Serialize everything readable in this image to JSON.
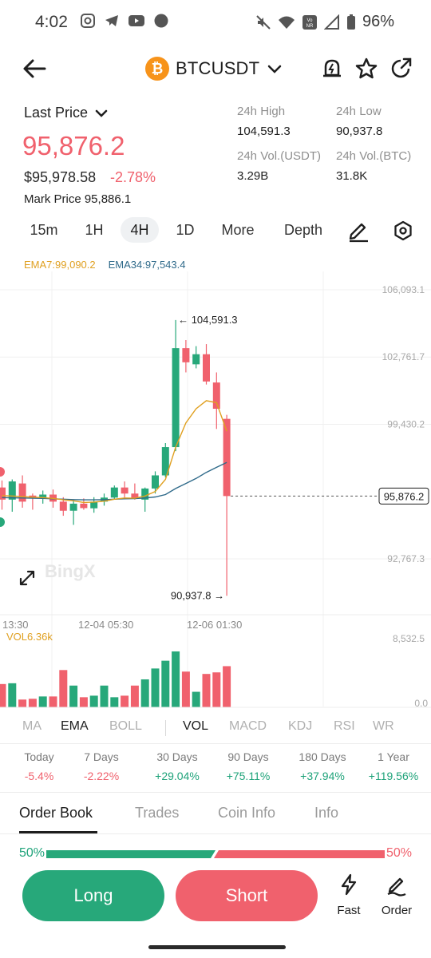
{
  "status_bar": {
    "time": "4:02",
    "battery": "96%",
    "network_badge": "Vo NR"
  },
  "header": {
    "coin_symbol": "₿",
    "pair": "BTCUSDT"
  },
  "price": {
    "label": "Last Price",
    "last": "95,876.2",
    "usd": "$95,978.58",
    "change": "-2.78%",
    "mark": "Mark Price 95,886.1"
  },
  "stats": {
    "high_label": "24h High",
    "high_value": "104,591.3",
    "low_label": "24h Low",
    "low_value": "90,937.8",
    "vol_usdt_label": "24h Vol.(USDT)",
    "vol_usdt_value": "3.29B",
    "vol_btc_label": "24h Vol.(BTC)",
    "vol_btc_value": "31.8K"
  },
  "timeframes": [
    "15m",
    "1H",
    "4H",
    "1D",
    "More",
    "Depth"
  ],
  "ema_legend": {
    "ema7": "EMA7:99,090.2",
    "ema34": "EMA34:97,543.4"
  },
  "chart_data": {
    "type": "candlestick",
    "y_axis_labels": [
      "106,093.1",
      "102,761.7",
      "99,430.2",
      "92,767.3"
    ],
    "ylim": [
      90000,
      107000
    ],
    "current_price_tag": "95,876.2",
    "high_annotation": "104,591.3",
    "low_annotation": "90,937.8",
    "x_labels": [
      "13:30",
      "12-04 05:30",
      "12-06 01:30"
    ],
    "watermark": "BingX",
    "candles": [
      {
        "o": 96300,
        "h": 96650,
        "l": 95200,
        "c": 95700
      },
      {
        "o": 95700,
        "h": 96700,
        "l": 95100,
        "c": 96600
      },
      {
        "o": 96500,
        "h": 96900,
        "l": 95300,
        "c": 95600
      },
      {
        "o": 95900,
        "h": 96000,
        "l": 95200,
        "c": 95780
      },
      {
        "o": 95800,
        "h": 96150,
        "l": 95500,
        "c": 95950
      },
      {
        "o": 95950,
        "h": 96200,
        "l": 95300,
        "c": 95600
      },
      {
        "o": 95600,
        "h": 95820,
        "l": 94900,
        "c": 95150
      },
      {
        "o": 95150,
        "h": 95700,
        "l": 94450,
        "c": 95500
      },
      {
        "o": 95500,
        "h": 95760,
        "l": 95200,
        "c": 95280
      },
      {
        "o": 95270,
        "h": 95820,
        "l": 95050,
        "c": 95600
      },
      {
        "o": 95600,
        "h": 96000,
        "l": 95400,
        "c": 95800
      },
      {
        "o": 95800,
        "h": 96400,
        "l": 95700,
        "c": 96300
      },
      {
        "o": 96300,
        "h": 96600,
        "l": 95800,
        "c": 96000
      },
      {
        "o": 96000,
        "h": 96500,
        "l": 95700,
        "c": 95750
      },
      {
        "o": 95700,
        "h": 96300,
        "l": 95100,
        "c": 96250
      },
      {
        "o": 96250,
        "h": 97100,
        "l": 96000,
        "c": 96900
      },
      {
        "o": 96900,
        "h": 98500,
        "l": 96800,
        "c": 98300
      },
      {
        "o": 98300,
        "h": 104591.3,
        "l": 98100,
        "c": 103200
      },
      {
        "o": 103200,
        "h": 103600,
        "l": 102000,
        "c": 102500
      },
      {
        "o": 102400,
        "h": 103300,
        "l": 102200,
        "c": 102900
      },
      {
        "o": 102900,
        "h": 103400,
        "l": 101400,
        "c": 101550
      },
      {
        "o": 101500,
        "h": 102000,
        "l": 99200,
        "c": 100200
      },
      {
        "o": 99700,
        "h": 99900,
        "l": 90937.8,
        "c": 95876.2
      }
    ],
    "ema7": [
      95900,
      95880,
      95850,
      95820,
      95800,
      95760,
      95690,
      95640,
      95560,
      95580,
      95620,
      95720,
      95780,
      95770,
      95880,
      96100,
      96700,
      98300,
      99500,
      100200,
      100600,
      100500,
      99090.2
    ],
    "ema34": [
      95800,
      95790,
      95780,
      95770,
      95760,
      95740,
      95720,
      95700,
      95690,
      95690,
      95695,
      95720,
      95740,
      95750,
      95780,
      95830,
      95950,
      96250,
      96500,
      96750,
      97050,
      97300,
      97543.4
    ],
    "volume": {
      "label": "VOL6.36k",
      "axis_labels": [
        "8,532.5",
        "0.0"
      ],
      "ylim": [
        0,
        8532.5
      ],
      "values": [
        3000,
        3100,
        1000,
        1100,
        1400,
        1400,
        4800,
        2800,
        1300,
        1500,
        2800,
        1300,
        1500,
        2800,
        3600,
        5000,
        6000,
        7200,
        4600,
        2000,
        4300,
        4500,
        5300
      ]
    }
  },
  "indicators": [
    "MA",
    "EMA",
    "BOLL",
    "VOL",
    "MACD",
    "KDJ",
    "RSI",
    "WR"
  ],
  "performance": [
    {
      "label": "Today",
      "value": "-5.4%"
    },
    {
      "label": "7 Days",
      "value": "-2.22%"
    },
    {
      "label": "30 Days",
      "value": "+29.04%"
    },
    {
      "label": "90 Days",
      "value": "+75.11%"
    },
    {
      "label": "180 Days",
      "value": "+37.94%"
    },
    {
      "label": "1 Year",
      "value": "+119.56%"
    }
  ],
  "sub_tabs": [
    "Order Book",
    "Trades",
    "Coin Info",
    "Info"
  ],
  "ratio": {
    "long": "50%",
    "short": "50%",
    "long_fraction": 0.5
  },
  "actions": {
    "long": "Long",
    "short": "Short",
    "fast": "Fast",
    "order": "Order"
  },
  "colors": {
    "up": "#27a87a",
    "down": "#f0616d",
    "ema7": "#e0a020",
    "ema34": "#2f6a8a"
  }
}
